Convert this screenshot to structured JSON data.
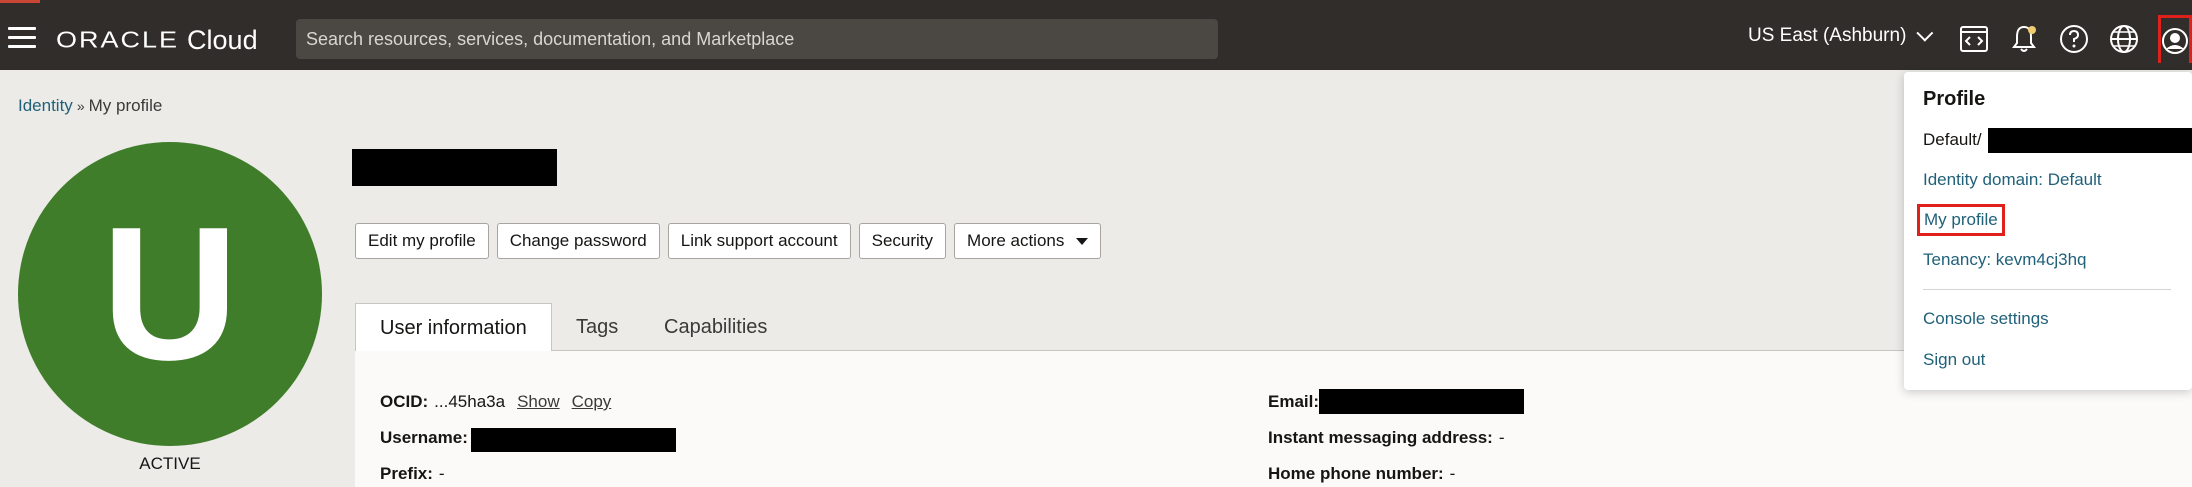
{
  "topbar": {
    "logo_oracle": "ORACLE",
    "logo_cloud": "Cloud",
    "search_placeholder": "Search resources, services, documentation, and Marketplace",
    "region": "US East (Ashburn)"
  },
  "breadcrumb": {
    "parent": "Identity",
    "current": "My profile"
  },
  "avatar": {
    "initial": "U",
    "color": "#3f7d2a"
  },
  "status": "ACTIVE",
  "actions": [
    "Edit my profile",
    "Change password",
    "Link support account",
    "Security",
    "More actions"
  ],
  "tabs": [
    "User information",
    "Tags",
    "Capabilities"
  ],
  "info": {
    "ocid_label": "OCID:",
    "ocid_value": "...45ha3a",
    "show": "Show",
    "copy": "Copy",
    "username_label": "Username:",
    "prefix_label": "Prefix:",
    "prefix_value": "-",
    "email_label": "Email:",
    "im_label": "Instant messaging address:",
    "im_value": "-",
    "home_phone_label": "Home phone number:",
    "home_phone_value": "-"
  },
  "profile_menu": {
    "title": "Profile",
    "default_prefix": "Default/",
    "identity_domain": "Identity domain: Default",
    "my_profile": "My profile",
    "tenancy": "Tenancy: kevm4cj3hq",
    "console_settings": "Console settings",
    "sign_out": "Sign out"
  },
  "colors": {
    "topbar": "#312d2a",
    "link": "#20617a",
    "highlight": "#e0211b"
  }
}
